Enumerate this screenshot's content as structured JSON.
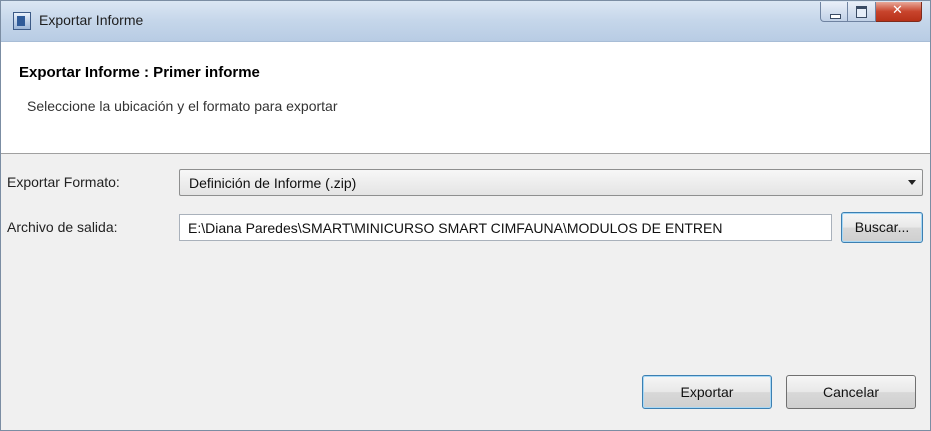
{
  "window": {
    "title": "Exportar Informe"
  },
  "header": {
    "title": "Exportar Informe : Primer informe",
    "subtitle": "Seleccione la ubicación y el formato para exportar"
  },
  "form": {
    "format_label": "Exportar Formato:",
    "format_value": "Definición de Informe (.zip)",
    "output_label": "Archivo de salida:",
    "output_value": "E:\\Diana Paredes\\SMART\\MINICURSO SMART CIMFAUNA\\MODULOS DE ENTREN",
    "browse_label": "Buscar..."
  },
  "footer": {
    "export_label": "Exportar",
    "cancel_label": "Cancelar"
  }
}
